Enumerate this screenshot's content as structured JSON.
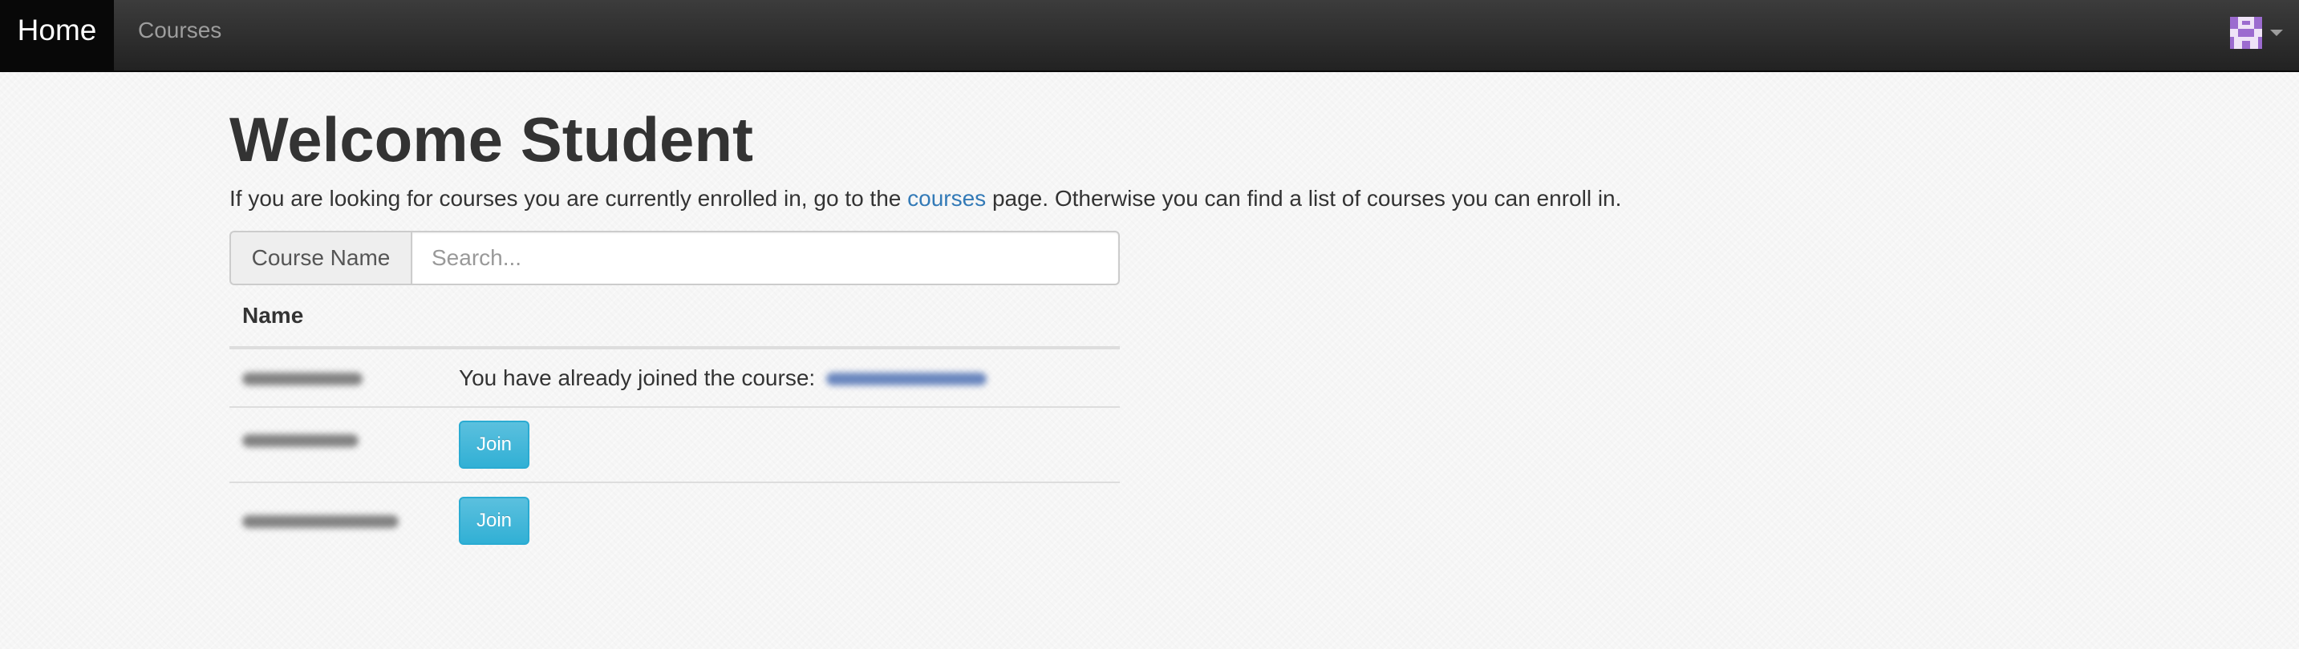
{
  "navbar": {
    "brand": "Home",
    "links": [
      "Courses"
    ]
  },
  "page": {
    "title": "Welcome Student",
    "intro_before": "If you are looking for courses you are currently enrolled in, go to the ",
    "intro_link": "courses",
    "intro_after": " page. Otherwise you can find a list of courses you can enroll in."
  },
  "search": {
    "label": "Course Name",
    "placeholder": "Search...",
    "value": ""
  },
  "table": {
    "header_name": "Name",
    "rows": [
      {
        "status_text": "You have already joined the course: "
      },
      {
        "button_label": "Join"
      },
      {
        "button_label": "Join"
      }
    ]
  },
  "colors": {
    "navbar_bg": "#222222",
    "brand_bg": "#080808",
    "link": "#337ab7",
    "info_button": "#5bc0de"
  },
  "icons": {
    "avatar": "identicon-avatar",
    "caret": "caret-down-icon"
  }
}
